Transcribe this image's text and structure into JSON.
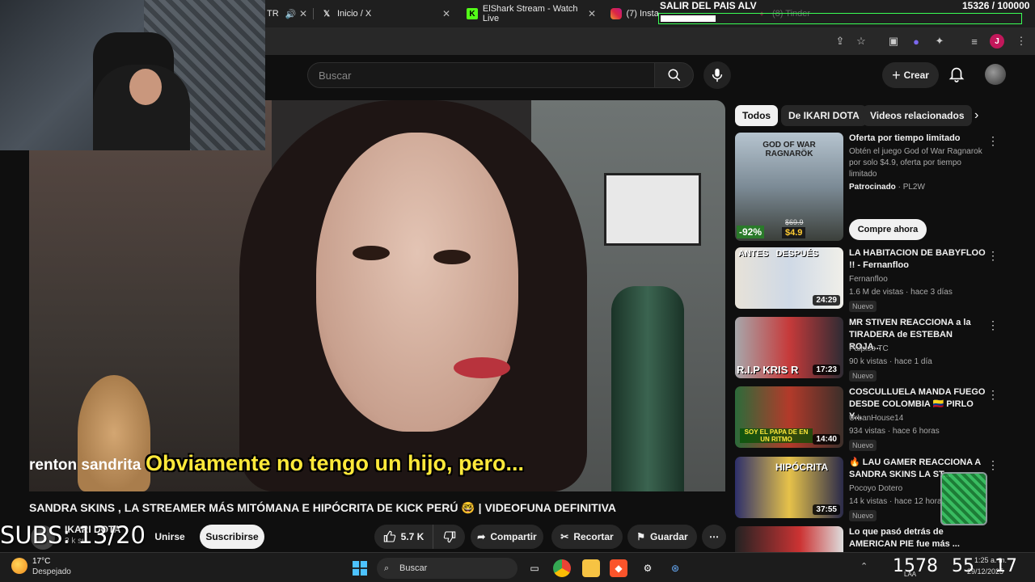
{
  "browser": {
    "tabs": [
      {
        "label": "TR",
        "icon": "speaker-icon"
      },
      {
        "label": "Inicio / X",
        "icon": "x-logo-icon"
      },
      {
        "label": "ElShark Stream - Watch Live",
        "icon": "kick-logo-icon"
      },
      {
        "label": "(7) Instagram",
        "icon": "instagram-icon"
      },
      {
        "label": "(8) Tinder",
        "icon": "tinder-icon"
      }
    ],
    "profile_initial": "J"
  },
  "overlay": {
    "goal_label": "SALIR DEL PAIS ALV",
    "goal_count": "15326 / 100000",
    "goal_progress": 0.153,
    "subs": "SUBS: 13/20"
  },
  "header": {
    "search_placeholder": "Buscar",
    "create_label": "Crear"
  },
  "video": {
    "subtitle_left": "renton sandrita",
    "subtitle_main": "Obviamente no tengo un hijo, pero...",
    "title": "SANDRA SKINS , LA STREAMER MÁS MITÓMANA E HIPÓCRITA DE KICK PERÚ 🤓 | VIDEOFUNA DEFINITIVA",
    "channel": "IKARI DOTA",
    "channel_subs": "3 k su",
    "join_label": "Unirse",
    "subscribe_label": "Suscribirse",
    "likes": "5.7 K",
    "share_label": "Compartir",
    "clip_label": "Recortar",
    "save_label": "Guardar"
  },
  "chips": [
    "Todos",
    "De IKARI DOTA",
    "Videos relacionados"
  ],
  "recommendations": [
    {
      "title": "Oferta por tiempo limitado",
      "desc": "Obtén el juego God of War Ragnarok por solo $4.9, oferta por tiempo limitado",
      "sponsor": "Patrocinado",
      "sponsor_name": "PL2W",
      "cta": "Compre ahora",
      "thumb_text": "GOD OF WAR RAGNARÖK",
      "discount": "-92%",
      "old_price": "$69.9",
      "price": "$4.9"
    },
    {
      "title": "LA HABITACION DE BABYFLOO !! - Fernanfloo",
      "channel": "Fernanfloo",
      "meta": "1.6 M de vistas · hace 3 días",
      "badge": "Nuevo",
      "duration": "24:29",
      "thumb_text": "ANTES   DESPUÉS"
    },
    {
      "title": "MR STIVEN REACCIONA a la TIRADERA de ESTEBAN ROJA...",
      "channel": "Palpiso TC",
      "meta": "90 k vistas · hace 1 día",
      "badge": "Nuevo",
      "duration": "17:23",
      "thumb_text": "R.I.P KRIS R"
    },
    {
      "title": "COSCULLUELA MANDA FUEGO DESDE COLOMBIA 🇨🇴 PIRLO Y...",
      "channel": "UrbanHouse14",
      "meta": "934 vistas · hace 6 horas",
      "badge": "Nuevo",
      "duration": "14:40",
      "thumb_text": "SOY EL PAPA DE EN UN RITMO"
    },
    {
      "title": "🔥 LAU GAMER REACCIONA A SANDRA SKINS LA ST...",
      "channel": "Pocoyo Dotero",
      "meta": "14 k vistas · hace 12 horas",
      "badge": "Nuevo",
      "duration": "37:55",
      "thumb_text": "HIPÓCRITA"
    },
    {
      "title": "Lo que pasó detrás de AMERICAN PIE fue más ...",
      "channel": "",
      "meta": "",
      "badge": "",
      "duration": "",
      "thumb_text": ""
    }
  ],
  "taskbar": {
    "weather_temp": "17°C",
    "weather_desc": "Despejado",
    "search_label": "Buscar",
    "left_num": "1578",
    "mid_num": "55",
    "right_num": "17",
    "time": "1:25 a. m.",
    "date": "29/12/2025",
    "lang": "LAA"
  }
}
